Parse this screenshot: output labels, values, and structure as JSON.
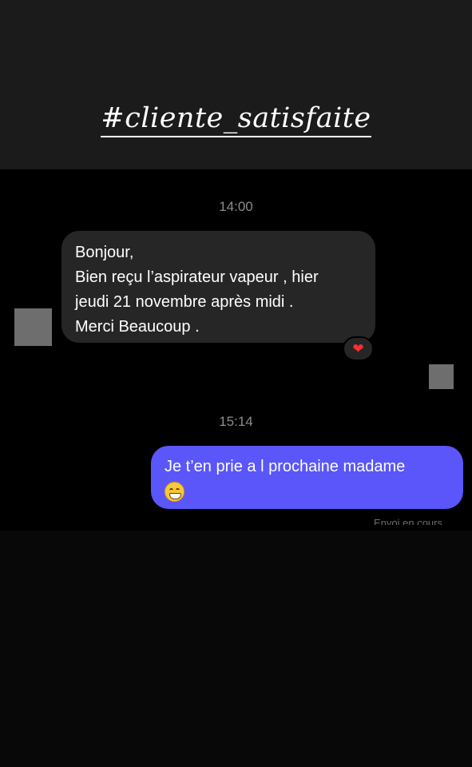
{
  "story": {
    "caption": "#cliente_satisfaite"
  },
  "conversation": {
    "messages": [
      {
        "timestamp": "14:00",
        "direction": "incoming",
        "lines": [
          "Bonjour,",
          "Bien reçu l’aspirateur vapeur , hier",
          "jeudi 21 novembre après midi .",
          "Merci Beaucoup ."
        ],
        "reaction": "❤"
      },
      {
        "timestamp": "15:14",
        "direction": "outgoing",
        "lines": [
          "Je t’en prie a l prochaine madame"
        ],
        "emoji": "grinning-face-with-smiling-eyes",
        "status": "Envoi en cours"
      }
    ]
  },
  "colors": {
    "header_band": "#1b1b1b",
    "chat_background": "#000000",
    "incoming_bubble": "#262626",
    "outgoing_bubble": "#5a56fa",
    "timestamp_text": "#8c8c8c",
    "reaction_heart": "#ff2d2d"
  }
}
